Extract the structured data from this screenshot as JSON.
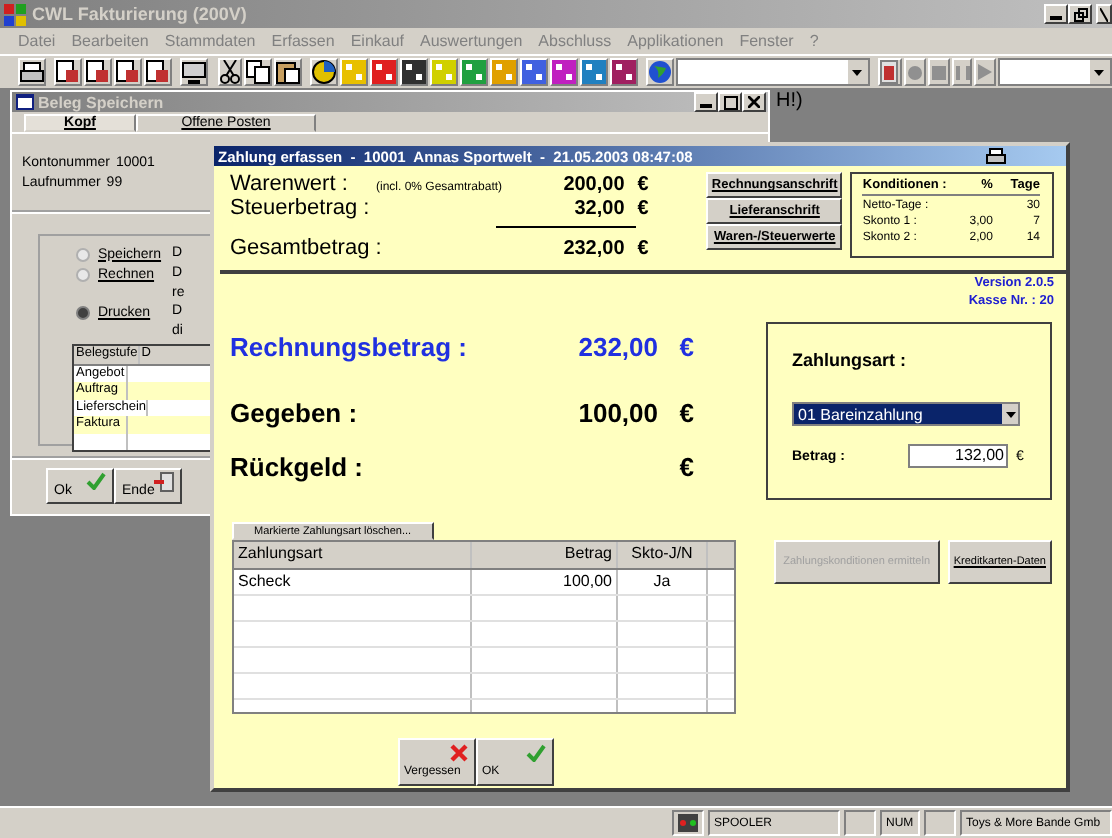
{
  "app_window": {
    "title": "CWL Fakturierung (200V)"
  },
  "menu": [
    "Datei",
    "Bearbeiten",
    "Stammdaten",
    "Erfassen",
    "Einkauf",
    "Auswertungen",
    "Abschluss",
    "Applikationen",
    "Fenster",
    "?"
  ],
  "background_text": "H!)",
  "beleg_window": {
    "title": "Beleg Speichern",
    "tabs": [
      {
        "label": "Kopf",
        "selected": true
      },
      {
        "label": "Offene Posten",
        "selected": false
      }
    ],
    "fields": [
      {
        "label": "Kontonummer",
        "value": "10001"
      },
      {
        "label": "Laufnummer",
        "value": "99"
      }
    ],
    "options": [
      {
        "label": "Speichern",
        "selected": false,
        "notes": [
          "D"
        ]
      },
      {
        "label": "Rechnen",
        "selected": false,
        "notes": [
          "D",
          "re"
        ]
      },
      {
        "label": "Drucken",
        "selected": true,
        "notes": [
          "D",
          "di"
        ]
      }
    ],
    "table": {
      "columns": [
        "Belegstufe",
        "D"
      ],
      "rows": [
        {
          "label": "Angebot",
          "highlighted": false
        },
        {
          "label": "Auftrag",
          "highlighted": true
        },
        {
          "label": "Lieferschein",
          "highlighted": false
        },
        {
          "label": "Faktura",
          "highlighted": true
        }
      ]
    },
    "buttons": [
      {
        "label": "Ok",
        "kind": "ok"
      },
      {
        "label": "Ende",
        "kind": "exit"
      }
    ]
  },
  "dialog": {
    "title": "Zahlung erfassen  -  10001  Annas Sportwelt  -  21.05.2003 08:47:08",
    "summary": [
      {
        "label": "Warenwert :",
        "note": "(incl. 0% Gesamtrabatt)",
        "amount": "200,00",
        "currency": "€"
      },
      {
        "label": "Steuerbetrag :",
        "amount": "32,00",
        "currency": "€"
      },
      {
        "label": "Gesamtbetrag :",
        "amount": "232,00",
        "currency": "€"
      }
    ],
    "address_buttons": [
      "Rechnungsanschrift",
      "Lieferanschrift",
      "Waren-/Steuerwerte"
    ],
    "conditions": {
      "columns": [
        "Konditionen :",
        "%",
        "Tage"
      ],
      "rows": [
        {
          "label": "Netto-Tage :",
          "days": "30"
        },
        {
          "label": "Skonto 1 :",
          "percent": "3,00",
          "days": "7"
        },
        {
          "label": "Skonto 2 :",
          "percent": "2,00",
          "days": "14"
        }
      ]
    },
    "version": "Version 2.0.5",
    "register": "Kasse Nr. : 20",
    "totals": [
      {
        "kind": "invoice",
        "label": "Rechnungsbetrag :",
        "amount": "232,00",
        "currency": "€"
      },
      {
        "kind": "given",
        "label": "Gegeben :",
        "amount": "100,00",
        "currency": "€"
      },
      {
        "kind": "change",
        "label": "Rückgeld :",
        "currency": "€"
      }
    ],
    "payment": {
      "heading": "Zahlungsart :",
      "method": "01 Bareinzahlung",
      "amount_label": "Betrag :",
      "amount": "132,00",
      "currency": "€"
    },
    "delete_tab": "Markierte Zahlungsart löschen...",
    "payments_table": {
      "columns": [
        "Zahlungsart",
        "Betrag",
        "Skto-J/N"
      ],
      "rows": [
        {
          "method": "Scheck",
          "amount": "100,00",
          "discount": "Ja"
        }
      ]
    },
    "side_buttons": [
      {
        "label": "Zahlungskonditionen ermitteln",
        "disabled": true
      },
      {
        "label": "Kreditkarten-Daten",
        "disabled": false
      }
    ],
    "footer_buttons": [
      {
        "label": "Vergessen",
        "kind": "cancel"
      },
      {
        "label": "OK",
        "kind": "ok"
      }
    ]
  },
  "status_bar": {
    "spooler": "SPOOLER",
    "num": "NUM",
    "company": "Toys & More Bande Gmb"
  }
}
